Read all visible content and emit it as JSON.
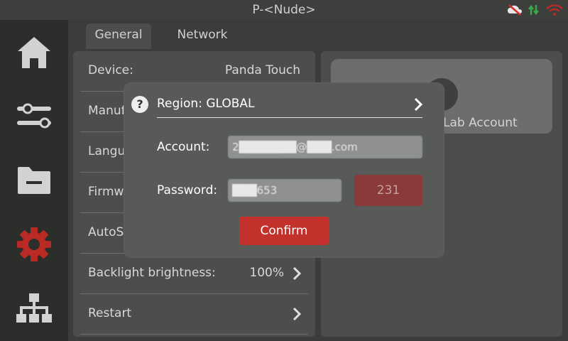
{
  "title": "P-<Nude>",
  "status_icons": [
    "no-cloud-icon",
    "transfer-arrows-icon",
    "wifi-error-icon"
  ],
  "colors": {
    "accent_red": "#c3312c",
    "active_nav": "#b92a25",
    "green": "#3ba54a"
  },
  "sidebar": {
    "items": [
      "home-icon",
      "sliders-icon",
      "folder-icon",
      "gear-icon",
      "network-icon"
    ],
    "active": "gear-icon"
  },
  "tabs": [
    {
      "label": "General",
      "active": true
    },
    {
      "label": "Network",
      "active": false
    }
  ],
  "settings": [
    {
      "label": "Device:",
      "value": "Panda Touch"
    },
    {
      "label": "Manuf",
      "value": ""
    },
    {
      "label": "Langu",
      "value": ""
    },
    {
      "label": "Firmw",
      "value": ""
    },
    {
      "label": "AutoSl",
      "value": ""
    },
    {
      "label": "Backlight brightness:",
      "value": "100%"
    },
    {
      "label": "Restart",
      "value": ""
    }
  ],
  "account_card": {
    "label": "Lab Account"
  },
  "dialog": {
    "help": "?",
    "region": "Region: GLOBAL",
    "account_label": "Account:",
    "account_value": "2███████@███.com",
    "password_label": "Password:",
    "password_value": "███653",
    "code": "231",
    "confirm": "Confirm"
  }
}
